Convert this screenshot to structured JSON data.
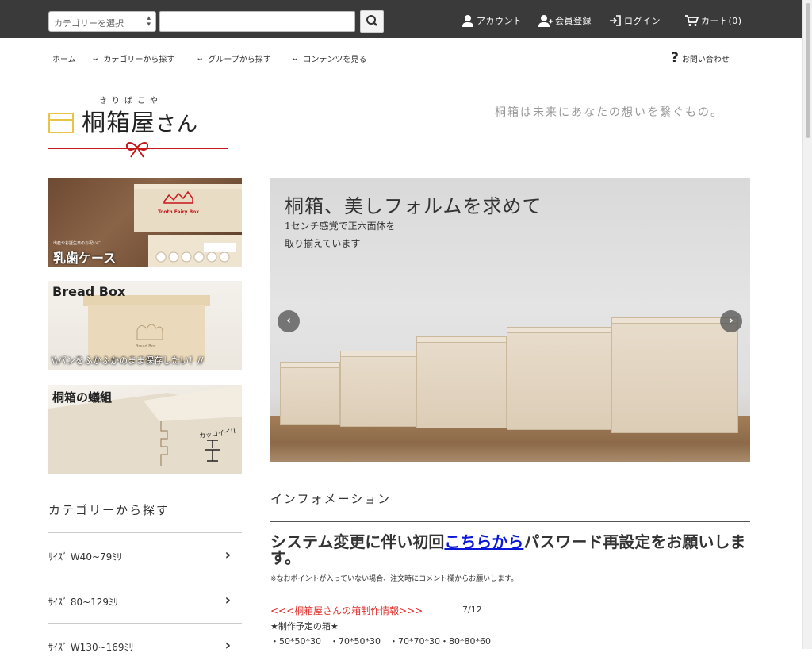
{
  "header": {
    "category_select": "カテゴリーを選択",
    "search_placeholder": "",
    "account": "アカウント",
    "register": "会員登録",
    "login": "ログイン",
    "cart": "カート(0)"
  },
  "nav": {
    "home": "ホーム",
    "by_category": "カテゴリーから探す",
    "by_group": "グループから探す",
    "contents": "コンテンツを見る",
    "contact": "お問い合わせ"
  },
  "logo": {
    "ruby": "きりばこや",
    "name_kanji": "桐箱屋",
    "name_kana": "さん"
  },
  "tagline": "桐箱は未来にあなたの想いを繋ぐもの。",
  "banners": [
    {
      "title": "乳歯ケース",
      "small": "出産やお誕生日のお祝いに",
      "box_label": "Tooth Fairy Box"
    },
    {
      "title": "Bread Box",
      "caption": "\\\\パンをふかふかのまま保存したい！//",
      "box_label": "Bread Box"
    },
    {
      "title": "桐箱の蟻組",
      "handwrite": "カッコイイ!!"
    }
  ],
  "sidebar": {
    "title": "カテゴリーから探す",
    "items": [
      {
        "label": "ｻｲｽﾞ  W40~79ﾐﾘ"
      },
      {
        "label": "ｻｲｽﾞ  80~129ﾐﾘ"
      },
      {
        "label": "ｻｲｽﾞ  W130~169ﾐﾘ"
      }
    ]
  },
  "hero": {
    "title": "桐箱、美しフォルムを求めて",
    "sub1": "1センチ感覚で正六面体を",
    "sub2": "取り揃えています"
  },
  "info": {
    "title": "インフォメーション",
    "headline_pre": "システム変更に伴い初回",
    "headline_link": "こちらから",
    "headline_post": "パスワード再設定をお願いします。",
    "note": "※なおポイントが入っていない場合、注文時にコメント欄からお願いします。",
    "news_link": "<<<桐箱屋さんの箱制作情報>>>",
    "news_date": "7/12",
    "news_line1": "★制作予定の箱★",
    "news_line2": "・50*50*30　・70*50*30　・70*70*30・80*80*60"
  },
  "colors": {
    "topbar": "#3a3a3a",
    "accent_red": "#c8161d",
    "logo_yellow": "#e8c547",
    "link_blue": "#0b16d8",
    "news_red": "#e0332f"
  }
}
